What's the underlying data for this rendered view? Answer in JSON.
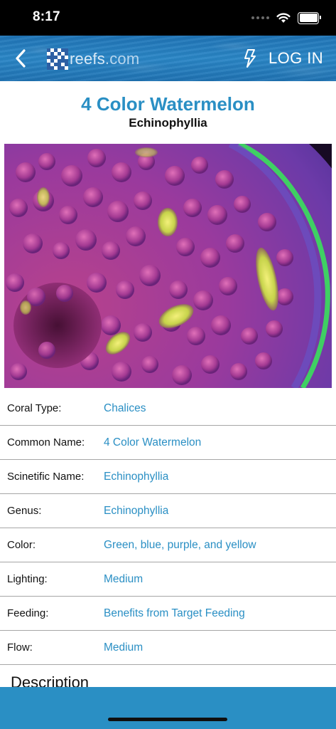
{
  "status_bar": {
    "time": "8:17"
  },
  "nav": {
    "logo_text": "reefs",
    "logo_suffix": ".com",
    "login_label": "LOG IN",
    "back_icon": "chevron-left-icon",
    "bolt_icon": "lightning-bolt-icon",
    "background_color": "#2a86c6"
  },
  "coral": {
    "title": "4 Color Watermelon",
    "subtitle": "Echinophyllia"
  },
  "details": [
    {
      "label": "Coral Type:",
      "value": "Chalices"
    },
    {
      "label": "Common Name:",
      "value": "4 Color Watermelon"
    },
    {
      "label": "Scinetific Name:",
      "value": "Echinophyllia"
    },
    {
      "label": "Genus:",
      "value": "Echinophyllia"
    },
    {
      "label": "Color:",
      "value": "Green, blue, purple, and yellow"
    },
    {
      "label": "Lighting:",
      "value": "Medium"
    },
    {
      "label": "Feeding:",
      "value": "Benefits from Target Feeding"
    },
    {
      "label": "Flow:",
      "value": "Medium"
    }
  ],
  "description_heading": "Description",
  "colors": {
    "accent": "#2a8fc4",
    "bottom_bar": "#2a8fc4"
  }
}
